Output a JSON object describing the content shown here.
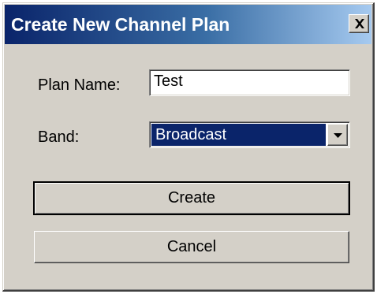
{
  "window": {
    "title": "Create New Channel Plan",
    "close_icon": "close-icon"
  },
  "form": {
    "plan_name_label": "Plan Name:",
    "plan_name_value": "Test",
    "band_label": "Band:",
    "band_value": "Broadcast",
    "band_dropdown_icon": "chevron-down-icon"
  },
  "buttons": {
    "create_label": "Create",
    "cancel_label": "Cancel"
  },
  "colors": {
    "titlebar_start": "#0a246a",
    "titlebar_end": "#a6caf0",
    "dialog_face": "#d4d0c8",
    "selection": "#0a246a"
  }
}
